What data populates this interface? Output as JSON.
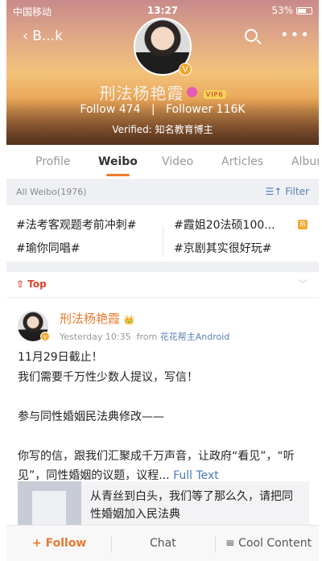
{
  "status_bar": {
    "carrier": "中国移动",
    "time": "13:27",
    "battery": "53%",
    "battery_level": 0.53
  },
  "nav": {
    "back_label": "B...k"
  },
  "profile": {
    "name": "刑法杨艳霞",
    "vip": "VIP6",
    "follow": "Follow  474",
    "follower": "Follower  116K",
    "separator": "|",
    "verified": "Verified: 知名教育博主",
    "verified_badge": "V"
  },
  "tabs": [
    {
      "label": "Profile"
    },
    {
      "label": "Weibo",
      "active": true
    },
    {
      "label": "Video"
    },
    {
      "label": "Articles"
    },
    {
      "label": "Album"
    }
  ],
  "filter_bar": {
    "all_label": "All Weibo(1976)",
    "filter_label": "Filter"
  },
  "topics": [
    "#法考客观题考前冲刺#",
    "#霞姐20法硕100...",
    "#瑜你同唱#",
    "#京剧其实很好玩#"
  ],
  "hot_badge": "热",
  "top_label": "Top",
  "post": {
    "author": "刑法杨艳霞",
    "time": "Yesterday 10:35",
    "from": "from",
    "source": "花花帮主Android",
    "text": "11月29日截止！\n我们需要千万性少数人提议，写信！\n\n参与同性婚姻民法典修改——\n\n你写的信，跟我们汇聚成千万声音，让政府“看见”，“听见”，同性婚姻的议题，议程...",
    "full_text": "Full Text",
    "card_title": "从青丝到白头，我们等了那么久，请把同性婚姻加入民法典"
  },
  "bottom_bar": {
    "follow": "+ Follow",
    "chat": "Chat",
    "cool": "≡ Cool Content"
  },
  "colors": {
    "accent": "#f07a2a",
    "link": "#4a78b9",
    "top_red": "#d9442d",
    "verified": "#f2a72b"
  }
}
